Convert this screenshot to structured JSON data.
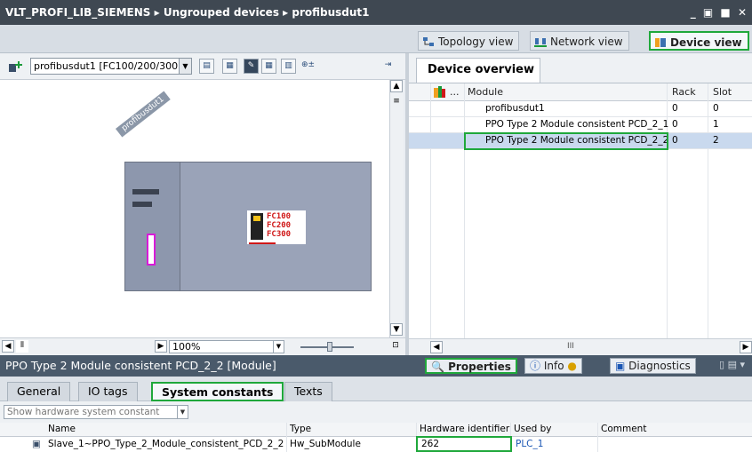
{
  "title": {
    "breadcrumb": [
      "VLT_PROFI_LIB_SIEMENS",
      "Ungrouped devices",
      "profibusdut1"
    ],
    "separator": "▸",
    "window_controls": "_ ▣ ■ ✕"
  },
  "views": {
    "topology": "Topology view",
    "network": "Network view",
    "device": "Device view"
  },
  "toolbar": {
    "device_select": "profibusdut1 [FC100/200/300",
    "zoom": "100%"
  },
  "canvas": {
    "device_label": "profibusdut1",
    "module_lines": [
      "FC100",
      "FC200",
      "FC300"
    ]
  },
  "overview": {
    "tab": "Device overview",
    "columns": {
      "icon": "",
      "dots": "...",
      "module": "Module",
      "rack": "Rack",
      "slot": "Slot"
    },
    "rows": [
      {
        "module": "profibusdut1",
        "rack": "0",
        "slot": "0"
      },
      {
        "module": "PPO Type 2 Module consistent PCD_2_1",
        "rack": "0",
        "slot": "1"
      },
      {
        "module": "PPO Type 2 Module consistent PCD_2_2",
        "rack": "0",
        "slot": "2"
      }
    ],
    "scroll_mark": "III"
  },
  "properties": {
    "title": "PPO Type 2 Module consistent PCD_2_2 [Module]",
    "tabs": {
      "properties": "Properties",
      "info": "Info",
      "diagnostics": "Diagnostics"
    },
    "subtabs": [
      "General",
      "IO tags",
      "System constants",
      "Texts"
    ],
    "filter": "Show hardware system constant",
    "columns": {
      "name": "Name",
      "type": "Type",
      "hwid": "Hardware identifier",
      "used_by": "Used by",
      "comment": "Comment"
    },
    "row": {
      "name": "Slave_1~PPO_Type_2_Module_consistent_PCD_2_2",
      "type": "Hw_SubModule",
      "hwid": "262",
      "used_by": "PLC_1",
      "comment": ""
    }
  },
  "colors": {
    "title_bg": "#3f4852",
    "highlight": "#1fa83b",
    "selection": "#c9d9ee",
    "rack": "#9aa3b8"
  }
}
